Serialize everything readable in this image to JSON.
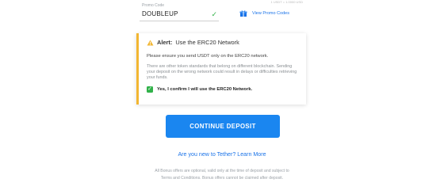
{
  "header": {
    "top_right_faint": "1 USDT = 1.0000 USD"
  },
  "promo": {
    "label": "Promo Code",
    "value": "DOUBLEUP",
    "view_label": "View Promo Codes"
  },
  "alert": {
    "prefix": "Alert:",
    "title": "Use the ERC20 Network",
    "line1": "Please ensure you send USDT only on the ERC20 network.",
    "muted": "There are other token standards that belong on different blockchain. Sending your deposit on the wrong network could result in delays or difficulties retrieving your funds.",
    "confirm_label": "Yes, I confirm I will use the ERC20 Network."
  },
  "actions": {
    "continue_label": "CONTINUE DEPOSIT",
    "tether_link": "Are you new to Tether? Learn More"
  },
  "footer": {
    "line1": "All Bonus offers are optional, valid only at the time of deposit and subject to",
    "line2": "Terms and Conditions. Bonus offers cannot be claimed after deposit."
  },
  "colors": {
    "accent_blue": "#1a86f0",
    "link_blue": "#1a73e8",
    "warning_yellow": "#f2b632",
    "success_green": "#31b24a"
  }
}
